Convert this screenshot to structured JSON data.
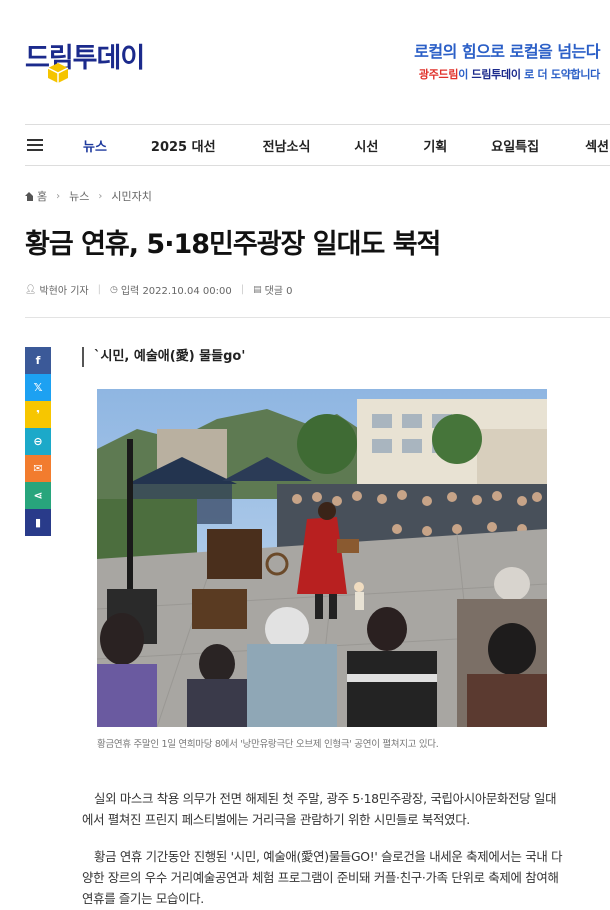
{
  "header": {
    "logo_text": "드림투데이",
    "slogan_line1": "로컬의 힘으로 로컬을 넘는다",
    "slogan_line2_part1": "광주드림",
    "slogan_line2_part2": "이 ",
    "slogan_line2_part3": "드림투데이",
    "slogan_line2_part4": " 로 더 도약합니다"
  },
  "nav": {
    "items": [
      "뉴스",
      "2025 대선",
      "전남소식",
      "시선",
      "기획",
      "요일특집",
      "섹션"
    ]
  },
  "breadcrumb": {
    "home": "홈",
    "level1": "뉴스",
    "level2": "시민자치"
  },
  "article": {
    "title": "황금 연휴, 5·18민주광장 일대도 북적",
    "author": "박현아 기자",
    "date": "입력 2022.10.04 00:00",
    "comments": "댓글 0",
    "subtitle": "`시민, 예술애(愛) 물들go'",
    "caption": "황금연휴 주말인 1일 연희마당 8에서 '낭만유랑극단 오브제 인형극' 공연이 펼쳐지고 있다.",
    "paragraph1": "실외 마스크 착용 의무가 전면 해제된 첫 주말, 광주 5·18민주광장, 국립아시아문화전당 일대에서 펼쳐진 프린지 페스티벌에는 거리극을 관람하기 위한 시민들로 북적였다.",
    "paragraph2": "황금 연휴 기간동안 진행된 '시민, 예술애(愛연)물들GO!' 슬로건을 내세운 축제에서는 국내 다양한 장르의 우수 거리예술공연과 체험 프로그램이 준비돼 커플·친구·가족 단위로 축제에 참여해 연휴를 즐기는 모습이다."
  },
  "share_buttons": [
    {
      "name": "facebook-icon",
      "glyph": "f",
      "color": "#3b5998"
    },
    {
      "name": "x-twitter-icon",
      "glyph": "𝕏",
      "color": "#1da1f2"
    },
    {
      "name": "kakao-story-icon",
      "glyph": "❜",
      "color": "#f7c600"
    },
    {
      "name": "link-icon",
      "glyph": "⊖",
      "color": "#1ca9c9"
    },
    {
      "name": "email-icon",
      "glyph": "✉",
      "color": "#f27c2e"
    },
    {
      "name": "share-icon",
      "glyph": "⋖",
      "color": "#28a57c"
    },
    {
      "name": "bookmark-icon",
      "glyph": "▮",
      "color": "#293b8a"
    }
  ],
  "colors": {
    "brand_navy": "#1b2a8c",
    "brand_blue": "#2b5fc7",
    "brand_yellow": "#f5c400",
    "nav_active": "#1e3a9e"
  }
}
